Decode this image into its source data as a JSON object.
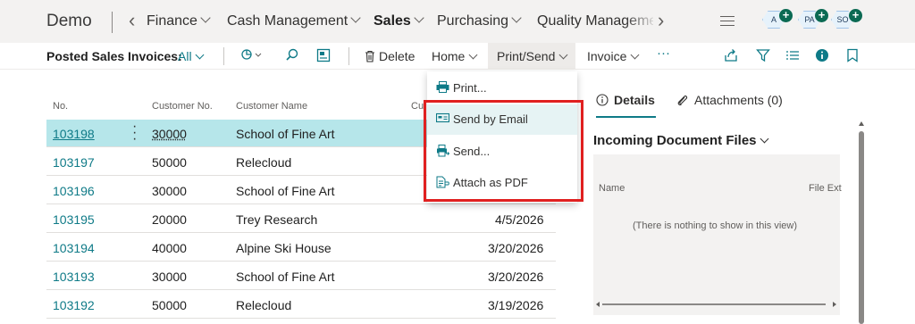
{
  "app": {
    "title": "Demo"
  },
  "nav": {
    "items": [
      {
        "label": "Finance"
      },
      {
        "label": "Cash Management"
      },
      {
        "label": "Sales"
      },
      {
        "label": "Purchasing"
      },
      {
        "label": "Quality Management"
      }
    ],
    "avatars": [
      "A",
      "PA",
      "SO"
    ]
  },
  "actionbar": {
    "page_title": "Posted Sales Invoices:",
    "view_filter": "All",
    "delete_label": "Delete",
    "home_label": "Home",
    "print_send_label": "Print/Send",
    "invoice_label": "Invoice",
    "more_label": "···"
  },
  "list": {
    "columns": [
      "No.",
      "Customer No.",
      "Customer Name",
      "Cu"
    ],
    "rows": [
      {
        "no": "103198",
        "customer_no": "30000",
        "customer_name": "School of Fine Art",
        "date": ""
      },
      {
        "no": "103197",
        "customer_no": "50000",
        "customer_name": "Relecloud",
        "date": ""
      },
      {
        "no": "103196",
        "customer_no": "30000",
        "customer_name": "School of Fine Art",
        "date": ""
      },
      {
        "no": "103195",
        "customer_no": "20000",
        "customer_name": "Trey Research",
        "date": "4/5/2026"
      },
      {
        "no": "103194",
        "customer_no": "40000",
        "customer_name": "Alpine Ski House",
        "date": "3/20/2026"
      },
      {
        "no": "103193",
        "customer_no": "30000",
        "customer_name": "School of Fine Art",
        "date": "3/20/2026"
      },
      {
        "no": "103192",
        "customer_no": "50000",
        "customer_name": "Relecloud",
        "date": "3/19/2026"
      }
    ]
  },
  "menu": {
    "items": [
      {
        "label": "Print...",
        "icon": "printer-icon"
      },
      {
        "label": "Send by Email",
        "icon": "email-icon"
      },
      {
        "label": "Send...",
        "icon": "send-icon"
      },
      {
        "label": "Attach as PDF",
        "icon": "attach-pdf-icon"
      }
    ]
  },
  "factbox": {
    "tabs": [
      "Details",
      "Attachments (0)"
    ],
    "section_title": "Incoming Document Files",
    "columns": [
      "Name",
      "File Ext"
    ],
    "empty_text": "(There is nothing to show in this view)"
  },
  "colors": {
    "accent": "#0e7a87",
    "selected_row": "#b6e6ea",
    "highlight": "#e02020"
  }
}
